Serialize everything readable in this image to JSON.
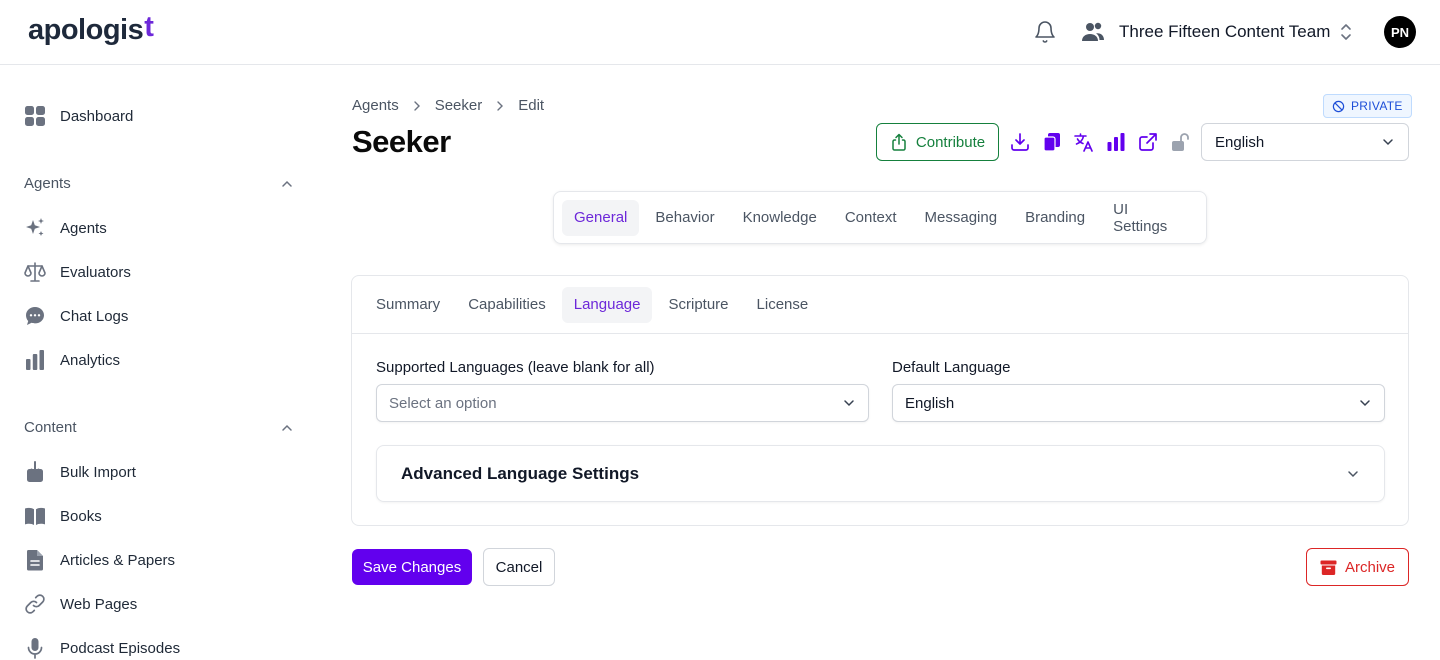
{
  "brand": {
    "logo_text": "apologis",
    "logo_cross": "t"
  },
  "header": {
    "team_name": "Three Fifteen Content Team",
    "avatar_initials": "PN"
  },
  "sidebar": {
    "dashboard": "Dashboard",
    "agents_section": "Agents",
    "agents_items": [
      "Agents",
      "Evaluators",
      "Chat Logs",
      "Analytics"
    ],
    "content_section": "Content",
    "content_items": [
      "Bulk Import",
      "Books",
      "Articles & Papers",
      "Web Pages",
      "Podcast Episodes"
    ]
  },
  "breadcrumb": [
    "Agents",
    "Seeker",
    "Edit"
  ],
  "badge": {
    "label": "PRIVATE"
  },
  "page": {
    "title": "Seeker"
  },
  "toolbar": {
    "contribute_label": "Contribute",
    "language_value": "English"
  },
  "main_tabs": [
    "General",
    "Behavior",
    "Knowledge",
    "Context",
    "Messaging",
    "Branding",
    "UI Settings"
  ],
  "main_tab_active": "General",
  "sub_tabs": [
    "Summary",
    "Capabilities",
    "Language",
    "Scripture",
    "License"
  ],
  "sub_tab_active": "Language",
  "form": {
    "supported_label": "Supported Languages (leave blank for all)",
    "supported_placeholder": "Select an option",
    "default_label": "Default Language",
    "default_value": "English",
    "advanced_title": "Advanced Language Settings"
  },
  "actions": {
    "save_label": "Save Changes",
    "cancel_label": "Cancel",
    "archive_label": "Archive"
  },
  "colors": {
    "accent": "#6200ee",
    "brand_purple": "#6d28d9",
    "success": "#15803d",
    "danger": "#dc2626",
    "private_blue": "#1d4ed8"
  },
  "icons": [
    "bell-icon",
    "users-icon",
    "chevrons-updown-icon",
    "dashboard-icon",
    "sparkles-icon",
    "scale-icon",
    "chat-icon",
    "bar-chart-icon",
    "import-icon",
    "book-icon",
    "document-icon",
    "link-icon",
    "microphone-icon",
    "upload-icon",
    "download-icon",
    "copy-icon",
    "translate-icon",
    "external-link-icon",
    "unlock-icon",
    "archive-icon",
    "eye-off-icon"
  ]
}
